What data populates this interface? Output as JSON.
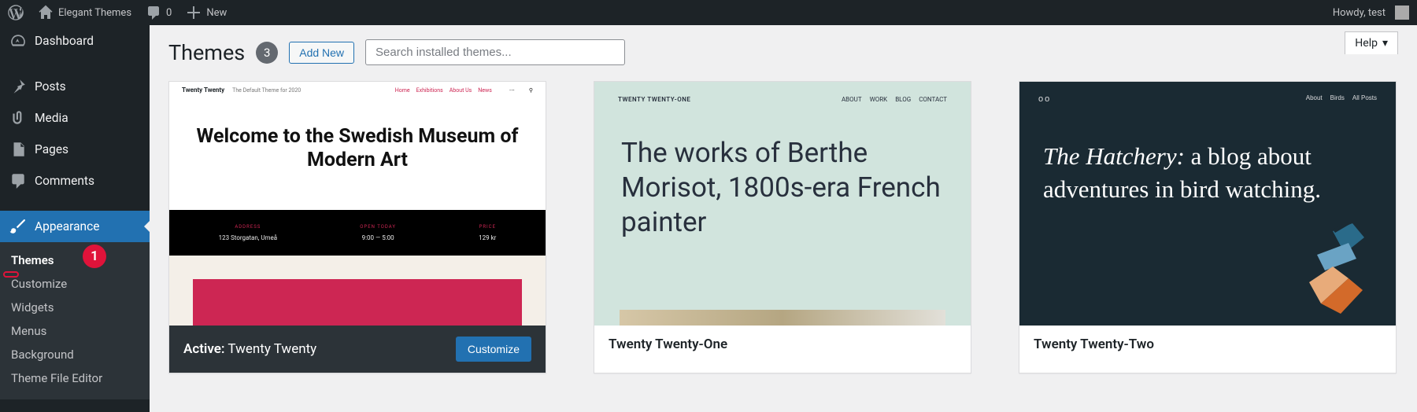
{
  "adminbar": {
    "site_name": "Elegant Themes",
    "comment_count": "0",
    "new_label": "New",
    "howdy": "Howdy, test"
  },
  "sidemenu": {
    "dashboard": "Dashboard",
    "posts": "Posts",
    "media": "Media",
    "pages": "Pages",
    "comments": "Comments",
    "appearance": "Appearance",
    "sub": {
      "themes": "Themes",
      "customize": "Customize",
      "widgets": "Widgets",
      "menus": "Menus",
      "background": "Background",
      "theme_file_editor": "Theme File Editor"
    }
  },
  "callout_number": "1",
  "content": {
    "help": "Help",
    "page_title": "Themes",
    "theme_count": "3",
    "add_new": "Add New",
    "search_placeholder": "Search installed themes..."
  },
  "themes": [
    {
      "active_label": "Active:",
      "name": "Twenty Twenty",
      "customize_btn": "Customize",
      "thumb": {
        "brand": "Twenty Twenty",
        "tagline": "The Default Theme for 2020",
        "nav": [
          "Home",
          "Exhibitions",
          "About Us",
          "News"
        ],
        "hero": "Welcome to the Swedish Museum of Modern Art",
        "col1_label": "ADDRESS",
        "col1_val": "123 Storgatan, Umeå",
        "col2_label": "OPEN TODAY",
        "col2_val": "9:00 — 5:00",
        "col3_label": "PRICE",
        "col3_val": "129 kr"
      }
    },
    {
      "name": "Twenty Twenty-One",
      "thumb": {
        "brand": "TWENTY TWENTY-ONE",
        "nav": [
          "ABOUT",
          "WORK",
          "BLOG",
          "CONTACT"
        ],
        "main": "The works of Berthe Morisot, 1800s-era French painter"
      }
    },
    {
      "name": "Twenty Twenty-Two",
      "thumb": {
        "logo": "oo",
        "nav": [
          "About",
          "Birds",
          "All Posts"
        ],
        "main_em": "The Hatchery:",
        "main_rest": " a blog about adventures in bird watching."
      }
    }
  ]
}
